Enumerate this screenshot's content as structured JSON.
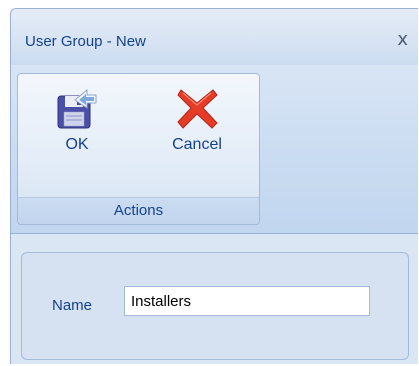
{
  "window": {
    "title": "User Group - New",
    "close_glyph": "x"
  },
  "ribbon": {
    "group_label": "Actions",
    "buttons": [
      {
        "label": "OK",
        "icon": "save-floppy-icon"
      },
      {
        "label": "Cancel",
        "icon": "red-x-icon"
      }
    ]
  },
  "form": {
    "name_label": "Name",
    "name_value": "Installers"
  },
  "colors": {
    "text": "#15428b",
    "window_bg": "#dbe6f4",
    "cancel_red": "#e53c28"
  }
}
